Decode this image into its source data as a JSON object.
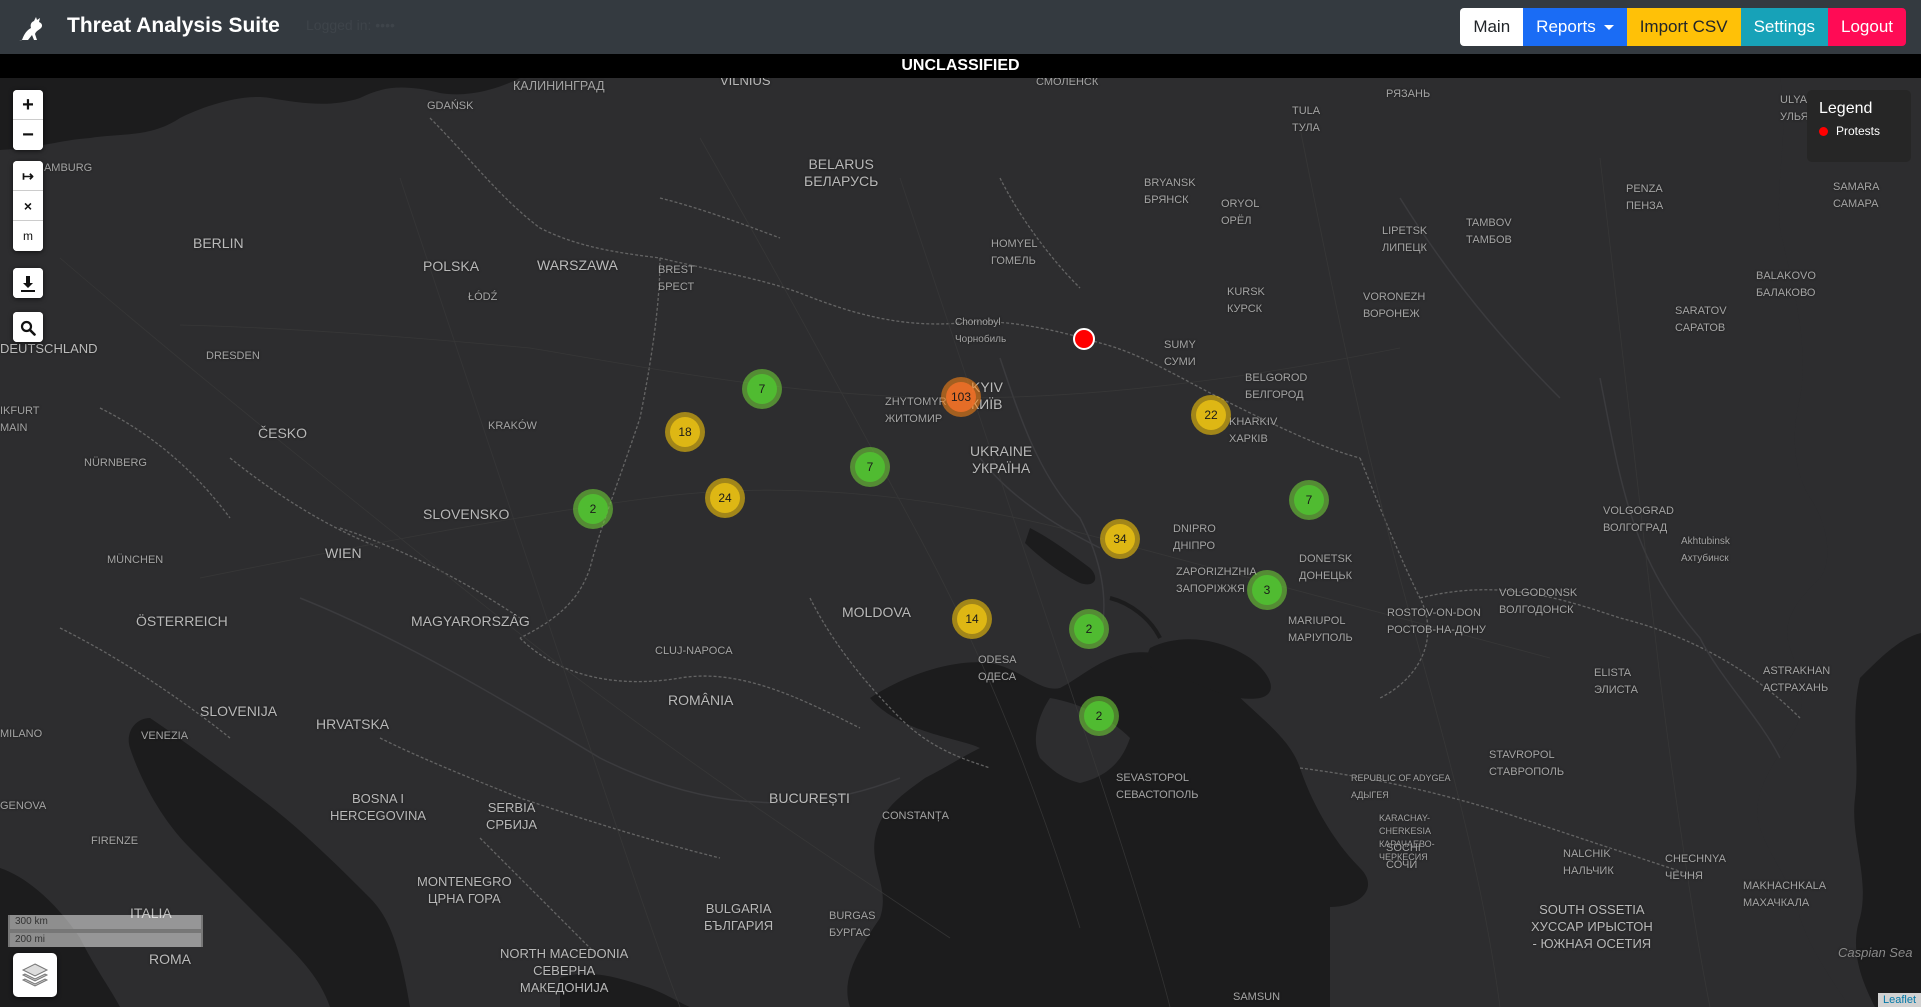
{
  "navbar": {
    "title": "Threat Analysis Suite",
    "subtitle": "Logged in: ••••",
    "buttons": {
      "main": "Main",
      "reports": "Reports",
      "import": "Import CSV",
      "settings": "Settings",
      "logout": "Logout"
    }
  },
  "banner": "UNCLASSIFIED",
  "legend": {
    "title": "Legend",
    "items": [
      {
        "label": "Protests",
        "color": "#ff0000"
      }
    ]
  },
  "controls": {
    "zoom_in": "+",
    "zoom_out": "−",
    "measure": "↦",
    "clear": "×",
    "units": "m"
  },
  "scale": {
    "km": "300 km",
    "mi": "200 mi"
  },
  "attribution": "Leaflet",
  "clusters": [
    {
      "count": "7",
      "level": "green"
    },
    {
      "count": "18",
      "level": "yellow"
    },
    {
      "count": "24",
      "level": "yellow"
    },
    {
      "count": "2",
      "level": "green"
    },
    {
      "count": "7",
      "level": "green"
    },
    {
      "count": "103",
      "level": "orange"
    },
    {
      "count": "22",
      "level": "yellow"
    },
    {
      "count": "7",
      "level": "green"
    },
    {
      "count": "34",
      "level": "yellow"
    },
    {
      "count": "3",
      "level": "green"
    },
    {
      "count": "14",
      "level": "yellow"
    },
    {
      "count": "2",
      "level": "green"
    },
    {
      "count": "2",
      "level": "green"
    }
  ],
  "places": [
    "КАЛИНИНГРАД",
    "VILNIUS",
    "СМОЛЕНСК",
    "РЯЗАНЬ",
    "GDAŃSK",
    "TULA\nТУЛА",
    "ULYAN\nУЛЬЯН",
    "HAMBURG",
    "BELARUS\nБЕЛАРУСЬ",
    "BRYANSK\nБРЯНСК",
    "ORYOL\nОРЁЛ",
    "TAMBOV\nТАМБОВ",
    "PENZA\nПЕНЗА",
    "SAMARA\nСАМАРА",
    "BERLIN",
    "HOMYEL\nГОМЕЛЬ",
    "LIPETSK\nЛИПЕЦК",
    "POLSKA",
    "WARSZAWA",
    "BREST\nБРЕСТ",
    "BALAKOVO\nБАЛАКОВО",
    "ŁÓDŹ",
    "KURSK\nКУРСК",
    "VORONEZH\nВОРОНЕЖ",
    "SARATOV\nСАРАТОВ",
    "Chornobyl\nЧорнобиль",
    "DEUTSCHLAND",
    "DRESDEN",
    "SUMY\nСУМИ",
    "BELGOROD\nБЕЛГОРОД",
    "KYIV\nКИЇВ",
    "ZHYTOMYR\nЖИТОМИР",
    "IKFURT\nMAIN",
    "ČESKO",
    "KRAKÓW",
    "KHARKIV\nХАРКІВ",
    "NÜRNBERG",
    "UKRAINE\nУКРАЇНА",
    "SLOVENSKO",
    "VOLGOGRAD\nВОЛГОГРАД",
    "DNIPRO\nДНІПРО",
    "Akhtubinsk\nАхтубинск",
    "MÜNCHEN",
    "WIEN",
    "ZAPORIZHZHIA\nЗАПОРІЖЖЯ",
    "DONETSK\nДОНЕЦЬК",
    "MOLDOVA",
    "VOLGODONSK\nВОЛГОДОНСК",
    "ÖSTERREICH",
    "MAGYARORSZÁG",
    "MARIUPOL\nМАРІУПОЛЬ",
    "ROSTOV-ON-DON\nРОСТОВ-НА-ДОНУ",
    "CLUJ-NAPOCA",
    "ODESA\nОДЕСА",
    "ELISTA\nЭЛИСТА",
    "ASTRAKHAN\nАСТРАХАНЬ",
    "ROMÂNIA",
    "SLOVENIJA",
    "HRVATSKA",
    "MILANO",
    "VENEZIA",
    "STAVROPOL\nСТАВРОПОЛЬ",
    "REPUBLIC OF ADYGEA\nАДЫГЕЯ",
    "SEVASTOPOL\nСЕВАСТОПОЛЬ",
    "BOSNA I\nHERCEGOVINA",
    "SERBIA\nСРБИЈА",
    "BUCUREȘTI",
    "CONSTANȚA",
    "GENOVA",
    "FIRENZE",
    "KARACHAY-\nCHERKESIA\nКАРАЧАЕВО-\nЧЕРКЕСИЯ",
    "NALCHIK\nНАЛЬЧИК",
    "CHECHNYA\nЧЕЧНЯ",
    "MAKHACHKALA\nМАХАЧКАЛА",
    "SOCHI\nСОЧИ",
    "MONTENEGRO\nЦРНА ГОРА",
    "ITALIA",
    "BULGARIA\nБЪЛГАРИЯ",
    "BURGAS\nБУРГАС",
    "SOUTH OSSETIA\nХУССАР ИРЫСТОН\n- ЮЖНАЯ ОСЕТИЯ",
    "Caspian Sea",
    "ROMA",
    "NORTH MACEDONIA\nСЕВЕРНА\nМАКЕДОНИЈА",
    "SAMSUN"
  ]
}
